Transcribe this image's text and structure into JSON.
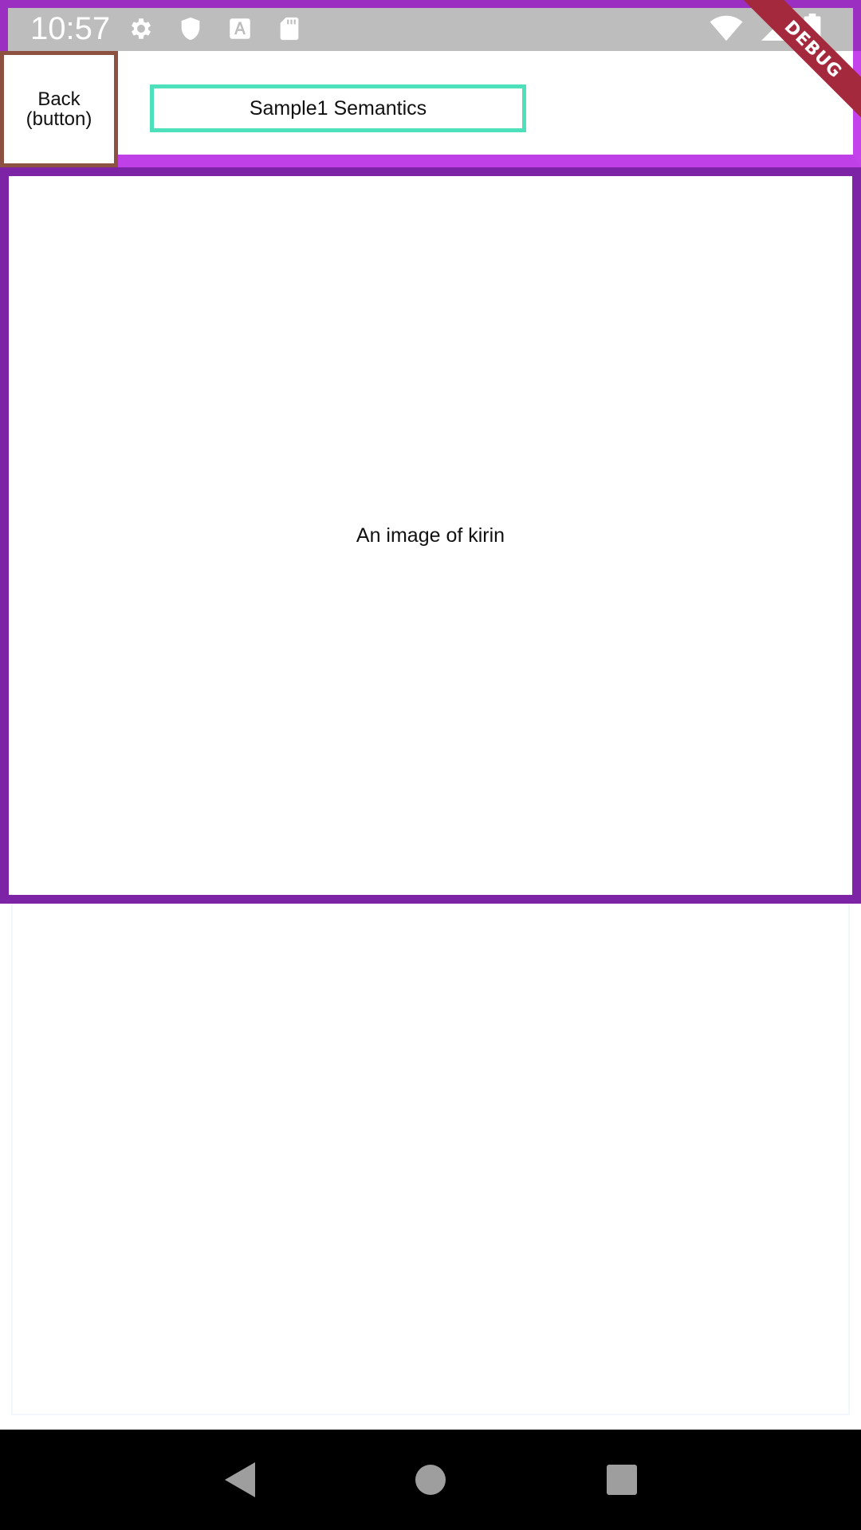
{
  "status_bar": {
    "time": "10:57",
    "left_icons": [
      "gear-icon",
      "shield-icon",
      "a-letter-icon",
      "sd-card-icon"
    ],
    "right_icons": [
      "wifi-icon",
      "signal-icon",
      "battery-icon"
    ]
  },
  "debug_banner": {
    "label": "DEBUG",
    "color": "#a5293c"
  },
  "app_bar": {
    "back_button_label": "Back\n(button)",
    "title": "Sample1 Semantics"
  },
  "image_region": {
    "label": "An image of kirin"
  },
  "colors": {
    "status_bar_bg": "#bdbdbd",
    "outline_purple": "#7d23a6",
    "appbar_purple": "#c040e8",
    "title_outline": "#4ee0bb",
    "back_outline": "#8d5142"
  },
  "nav_bar": {
    "buttons": [
      "back-triangle-icon",
      "home-circle-icon",
      "recents-square-icon"
    ]
  }
}
